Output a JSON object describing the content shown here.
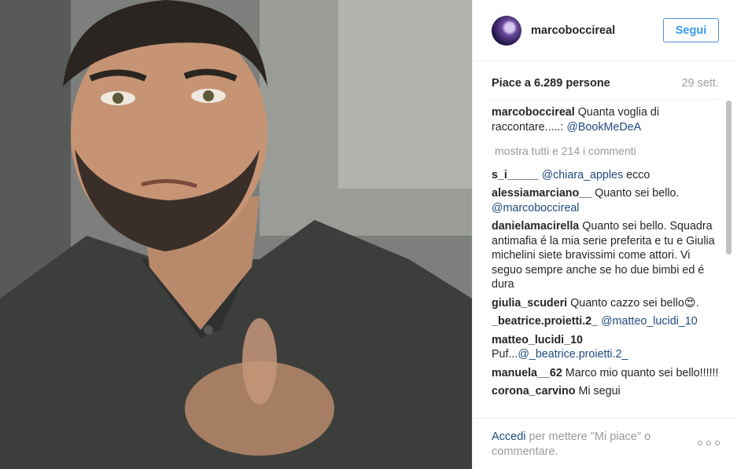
{
  "post": {
    "username": "marcoboccireal",
    "follow_label": "Segui",
    "likes": "Piace a 6.289 persone",
    "date": "29 sett.",
    "caption": {
      "user": "marcoboccireal",
      "text": "Quanta voglia di raccontare.....:",
      "mention": "@BookMeDeA"
    },
    "show_all_comments": "mostra tutti e 214 i commenti",
    "comments": [
      {
        "user": "s_i_____",
        "mention": "@chiara_apples",
        "text": "ecco"
      },
      {
        "user": "alessiamarciano__",
        "text": "Quanto sei bello.",
        "mention": "@marcoboccireal"
      },
      {
        "user": "danielamacirella",
        "text": "Quanto sei bello. Squadra antimafia é la mia serie preferita e tu e Giulia michelini siete bravissimi come attori. Vi seguo sempre anche se ho due bimbi ed é dura"
      },
      {
        "user": "giulia_scuderi",
        "text": "Quanto cazzo sei bello😍."
      },
      {
        "user": "_beatrice.proietti.2_",
        "mention": "@matteo_lucidi_10"
      },
      {
        "user": "matteo_lucidi_10",
        "text": "Puf...",
        "mention": "@_beatrice.proietti.2_"
      },
      {
        "user": "manuela__62",
        "text": "Marco mio quanto sei bello!!!!!!"
      },
      {
        "user": "corona_carvino",
        "text": "Mi segui"
      }
    ],
    "footer": {
      "login_link": "Accedi",
      "login_text": " per mettere \"Mi piace\" o commentare."
    },
    "icons": {
      "more": "more-options-icon",
      "avatar": "profile-avatar"
    }
  }
}
